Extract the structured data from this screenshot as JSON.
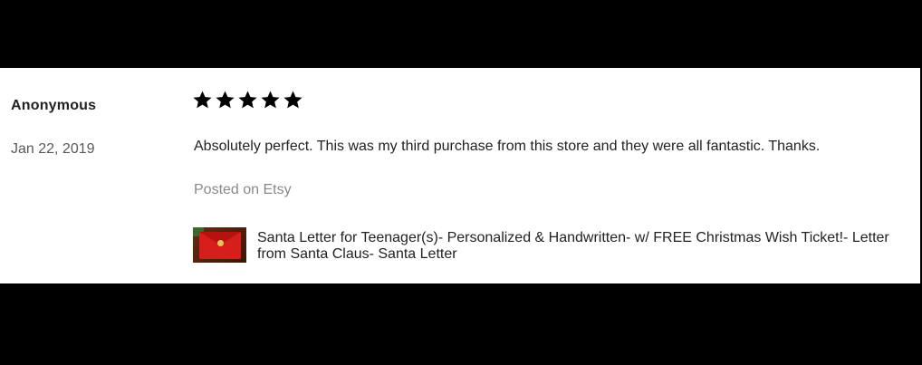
{
  "review": {
    "reviewer_name": "Anonymous",
    "date": "Jan 22, 2019",
    "rating": 5,
    "rating_max": 5,
    "text": "Absolutely perfect. This was my third purchase from this store and they were all fantastic. Thanks.",
    "source": "Posted on Etsy"
  },
  "listing": {
    "title": "Santa Letter for Teenager(s)- Personalized & Handwritten- w/ FREE Christmas Wish Ticket!- Letter from Santa Claus- Santa Letter"
  },
  "colors": {
    "star": "#000000",
    "background": "#ffffff",
    "text": "#222222",
    "muted": "#8a8a8a"
  }
}
